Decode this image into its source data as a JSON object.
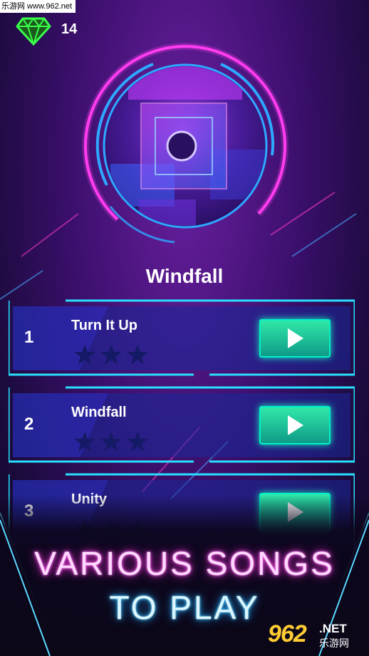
{
  "watermark": {
    "top": "乐游网 www.962.net",
    "logo_number": "962",
    "logo_suffix": ".NET",
    "logo_cn": "乐游网"
  },
  "gems": {
    "count": "14",
    "icon": "diamond-icon",
    "color": "#39ff4a"
  },
  "current_song": {
    "title": "Windfall"
  },
  "songs": [
    {
      "number": "1",
      "title": "Turn It Up",
      "stars_earned": 0,
      "stars_total": 3
    },
    {
      "number": "2",
      "title": "Windfall",
      "stars_earned": 0,
      "stars_total": 3
    },
    {
      "number": "3",
      "title": "Unity",
      "stars_earned": 0,
      "stars_total": 3
    }
  ],
  "tagline": {
    "line1": "VARIOUS SONGS",
    "line2": "TO PLAY"
  },
  "colors": {
    "neon_pink": "#ff2bd8",
    "neon_blue": "#1fa0ff",
    "neon_cyan": "#18f0c0",
    "play_green": "#30e8a8"
  }
}
